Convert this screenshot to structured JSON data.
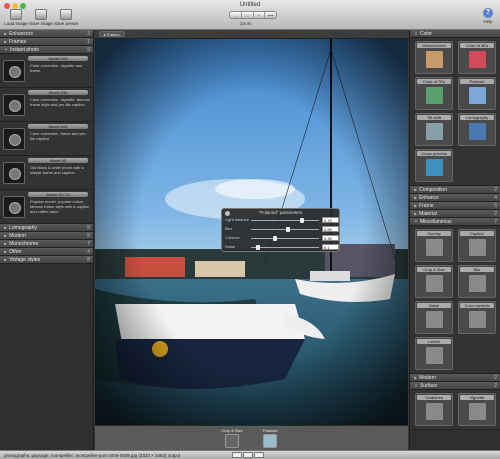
{
  "window": {
    "title": "Untitled"
  },
  "toolbar": {
    "load_label": "Load image",
    "save_label": "Save image",
    "save_preset_label": "Save preset",
    "zoom_label": "Zoom",
    "zoom_buttons": [
      "-",
      "□",
      "+",
      "⟷"
    ],
    "help_label": "Help"
  },
  "left_sections_top": [
    {
      "label": "Enhancers",
      "count": "3"
    },
    {
      "label": "Frames",
      "count": "1"
    },
    {
      "label": "Instant photo",
      "count": "5"
    }
  ],
  "presets": [
    {
      "name": "Model 103",
      "desc": "Color correction, vignette and frame."
    },
    {
      "name": "Model 636",
      "desc": "Color correction, vignette, famous frame style and per-file caption"
    },
    {
      "name": "Model 693",
      "desc": "Color correction, frame and per-file caption"
    },
    {
      "name": "Model 95",
      "desc": "Old black & white photo with a simple frame and caption"
    },
    {
      "name": "Model SX-70",
      "desc": "Popular model, popular colors, famous frame style with a caption and coffee trace"
    }
  ],
  "left_sections_bottom": [
    {
      "label": "Lomography",
      "count": "5"
    },
    {
      "label": "Modern",
      "count": "5"
    },
    {
      "label": "Monochrome",
      "count": "7"
    },
    {
      "label": "Other",
      "count": "4"
    },
    {
      "label": "Vintage styles",
      "count": "8"
    }
  ],
  "center": {
    "editors_label": "Editors"
  },
  "dialog": {
    "title": "\"Polaroid\" parameters",
    "params": [
      {
        "label": "Light balance",
        "value": "0.75",
        "pos": 0.75
      },
      {
        "label": "Blur",
        "value": "0.55",
        "pos": 0.55
      },
      {
        "label": "Colorize",
        "value": "0.35",
        "pos": 0.35
      },
      {
        "label": "Noise",
        "value": "0.1",
        "pos": 0.1
      }
    ]
  },
  "stack": [
    {
      "label": "Crop & Size",
      "icon": "crop-icon"
    },
    {
      "label": "Polaroid",
      "icon": "polaroid-icon"
    }
  ],
  "right": {
    "color_header": "Color",
    "color_tiles": [
      {
        "label": "Monochrome",
        "icon": "monochrome-icon",
        "color": "#c89a6a"
      },
      {
        "label": "Color of 50's",
        "icon": "color50-icon",
        "color": "#d24b5a"
      },
      {
        "label": "Color of 70's",
        "icon": "color70-icon",
        "color": "#5aa070"
      },
      {
        "label": "Polaroid",
        "icon": "polaroid-icon",
        "color": "#7aa8d8"
      },
      {
        "label": "Tilt-shift",
        "icon": "tiltshift-icon",
        "color": "#8aa0a8"
      },
      {
        "label": "Lomography",
        "icon": "lomography-icon",
        "color": "#4a78b0"
      },
      {
        "label": "Cross process",
        "icon": "crossprocess-icon",
        "color": "#3f8fbf"
      }
    ],
    "mid_sections": [
      {
        "label": "Composition",
        "count": "2"
      },
      {
        "label": "Enhance",
        "count": "4"
      },
      {
        "label": "Frame",
        "count": "5"
      },
      {
        "label": "Material",
        "count": "2"
      },
      {
        "label": "Miscellaneous",
        "count": "7"
      }
    ],
    "misc_tiles": [
      {
        "label": "Overlay",
        "icon": "overlay-icon"
      },
      {
        "label": "Caption",
        "icon": "caption-icon"
      },
      {
        "label": "Crop & Size",
        "icon": "crop-icon"
      },
      {
        "label": "Blur",
        "icon": "blur-icon"
      },
      {
        "label": "Noise",
        "icon": "noise-icon"
      },
      {
        "label": "Color controls",
        "icon": "sliders-icon"
      },
      {
        "label": "Levels",
        "icon": "levels-icon"
      }
    ],
    "bottom_sections": [
      {
        "label": "Modern",
        "count": "2"
      },
      {
        "label": "Surface",
        "count": "2"
      }
    ],
    "surface_tiles": [
      {
        "label": "Scratches",
        "icon": "scratches-icon"
      },
      {
        "label": "Vignette",
        "icon": "vignette-icon"
      }
    ]
  },
  "status": {
    "path": "photographs: paysage: montpellier: montpellier-port-2009-0009.jpg (2323 × 3483) output"
  }
}
